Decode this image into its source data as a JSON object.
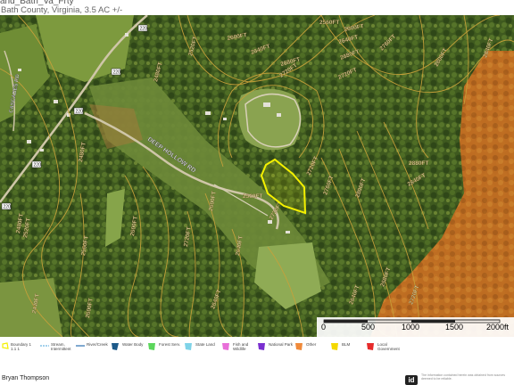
{
  "header": {
    "title": "and_Bath_Va_Frty",
    "subtitle": "Bath County, Virginia, 3.5 AC +/-"
  },
  "map": {
    "road_label": "DEEP HOLLOW RD",
    "side_road_label": "CASCADES RD",
    "route_shields": [
      "220",
      "220",
      "220",
      "220"
    ],
    "contour_labels": [
      "2640FT",
      "2680FT",
      "2720FT",
      "2560FT",
      "2600FT",
      "2760FT",
      "2800FT",
      "2840FT",
      "2880FT",
      "2920FT",
      "2520FT",
      "2480FT",
      "2440FT"
    ],
    "colors": {
      "contour": "#c8a13a",
      "boundary": "#f4f000",
      "national_forest": "#e0822a"
    }
  },
  "scalebar": {
    "ticks": [
      "0",
      "500",
      "1000",
      "1500",
      "2000ft"
    ]
  },
  "legend": {
    "items": [
      {
        "label": "Boundary 1 1.1 1",
        "icon": "boundary-icon",
        "color": "#f4f000"
      },
      {
        "label": "Stream, Intermittent",
        "icon": "stream-intermittent-icon",
        "color": "#4aa3d8"
      },
      {
        "label": "River/Creek",
        "icon": "river-creek-icon",
        "color": "#2a6fb0"
      },
      {
        "label": "Water Body",
        "icon": "water-body-icon",
        "color": "#1d5a8a"
      },
      {
        "label": "Forest Serv.",
        "icon": "forest-service-icon",
        "color": "#5cd65c"
      },
      {
        "label": "State Land",
        "icon": "state-land-icon",
        "color": "#7fd3e8"
      },
      {
        "label": "Fish and Wildlife",
        "icon": "fish-wildlife-icon",
        "color": "#e86fd8"
      },
      {
        "label": "National Park",
        "icon": "national-park-icon",
        "color": "#7a2fd0"
      },
      {
        "label": "Other",
        "icon": "other-icon",
        "color": "#f08a3a"
      },
      {
        "label": "BLM",
        "icon": "blm-icon",
        "color": "#f4d800"
      },
      {
        "label": "Local Government",
        "icon": "local-gov-icon",
        "color": "#e62a2a"
      }
    ]
  },
  "footer": {
    "agent_name": "Bryan Thompson",
    "logo_text": "id",
    "disclaimer": "The information contained herein was obtained from sources deemed to be reliable."
  }
}
